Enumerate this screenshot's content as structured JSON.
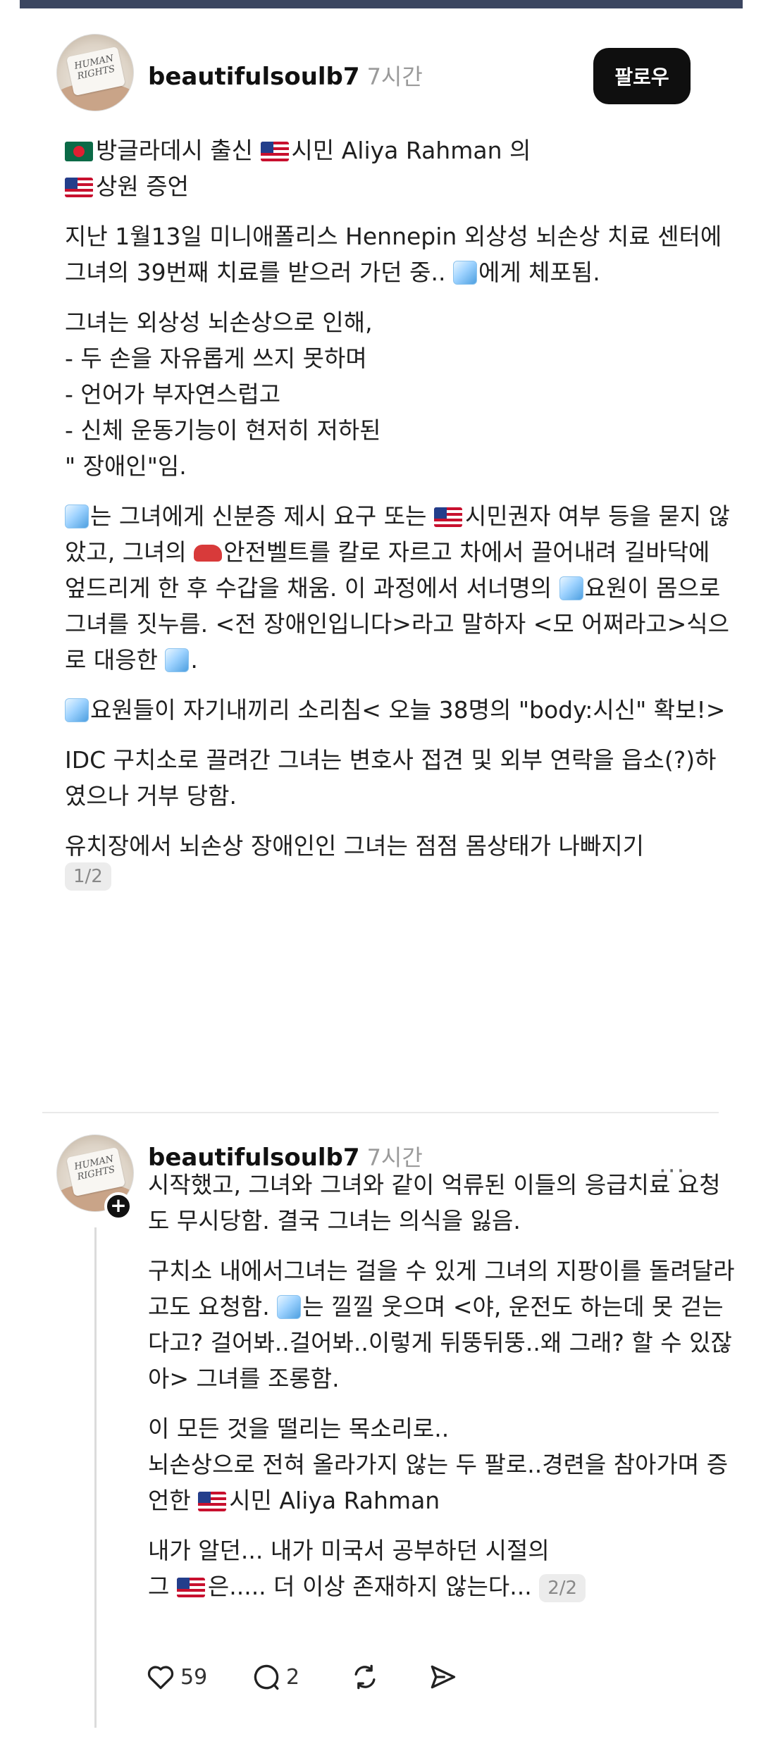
{
  "post1": {
    "username": "beautifulsoulb7",
    "time": "7시간",
    "follow_label": "팔로우",
    "avatar_text": "HUMAN RIGHTS",
    "p1_a": "방글라데시 출신 ",
    "p1_b": "시민 Aliya Rahman 의",
    "p1_c": "상원 증언",
    "p2_a": "지난 1월13일 미니애폴리스 Hennepin 외상성 뇌손상 치료 센터에 그녀의 39번째 치료를 받으러 가던 중.. ",
    "p2_b": "에게 체포됨.",
    "p3": "그녀는 외상성 뇌손상으로 인해,\n- 두 손을 자유롭게 쓰지 못하며\n- 언어가 부자연스럽고\n- 신체 운동기능이 현저히 저하된\n\" 장애인\"임.",
    "p4_a": "는 그녀에게 신분증 제시 요구 또는 ",
    "p4_b": "시민권자 여부 등을 묻지 않았고, 그녀의 ",
    "p4_c": "안전벨트를 칼로 자르고 차에서 끌어내려 길바닥에 엎드리게 한 후 수갑을 채움. 이 과정에서 서너명의 ",
    "p4_d": "요원이 몸으로 그녀를 짓누름. <전 장애인입니다>라고 말하자 <모 어쩌라고>식으로 대응한 ",
    "p4_e": ".",
    "p5_a": "요원들이 자기내끼리 소리침< 오늘 38명의 \"body:시신\" 확보!>",
    "p6": "IDC 구치소로 끌려간 그녀는 변호사 접견  및 외부 연락을 읍소(?)하였으나 거부 당함.",
    "p7": "유치장에서 뇌손상 장애인인 그녀는 점점 몸상태가 나빠지기",
    "counter": "1/2"
  },
  "post2": {
    "username": "beautifulsoulb7",
    "time": "7시간",
    "more": "···",
    "avatar_text": "HUMAN RIGHTS",
    "p1": "시작했고, 그녀와 그녀와 같이 억류된 이들의 응급치료 요청도 무시당함. 결국 그녀는 의식을 잃음.",
    "p2_a": "구치소 내에서그녀는 걸을 수 있게 그녀의 지팡이를 돌려달라고도 요청함. ",
    "p2_b": "는 낄낄 웃으며 <야, 운전도 하는데 못 걷는다고? 걸어봐..걸어봐..이렇게 뒤뚱뒤뚱..왜 그래? 할 수 있잖아> 그녀를 조롱함.",
    "p3_a": "이 모든 것을 떨리는 목소리로..\n뇌손상으로 전혀 올라가지 않는 두 팔로..경련을 참아가며 증언한 ",
    "p3_b": "시민 Aliya Rahman",
    "p4_a": "내가 알던... 내가 미국서 공부하던 시절의\n그 ",
    "p4_b": "은..... 더 이상 존재하지 않는다... ",
    "counter": "2/2",
    "likes": "59",
    "comments": "2"
  },
  "icons": {
    "bd_flag": "bangladesh-flag-icon",
    "us_flag": "us-flag-icon",
    "ice": "ice-cube-icon",
    "car": "car-icon"
  }
}
